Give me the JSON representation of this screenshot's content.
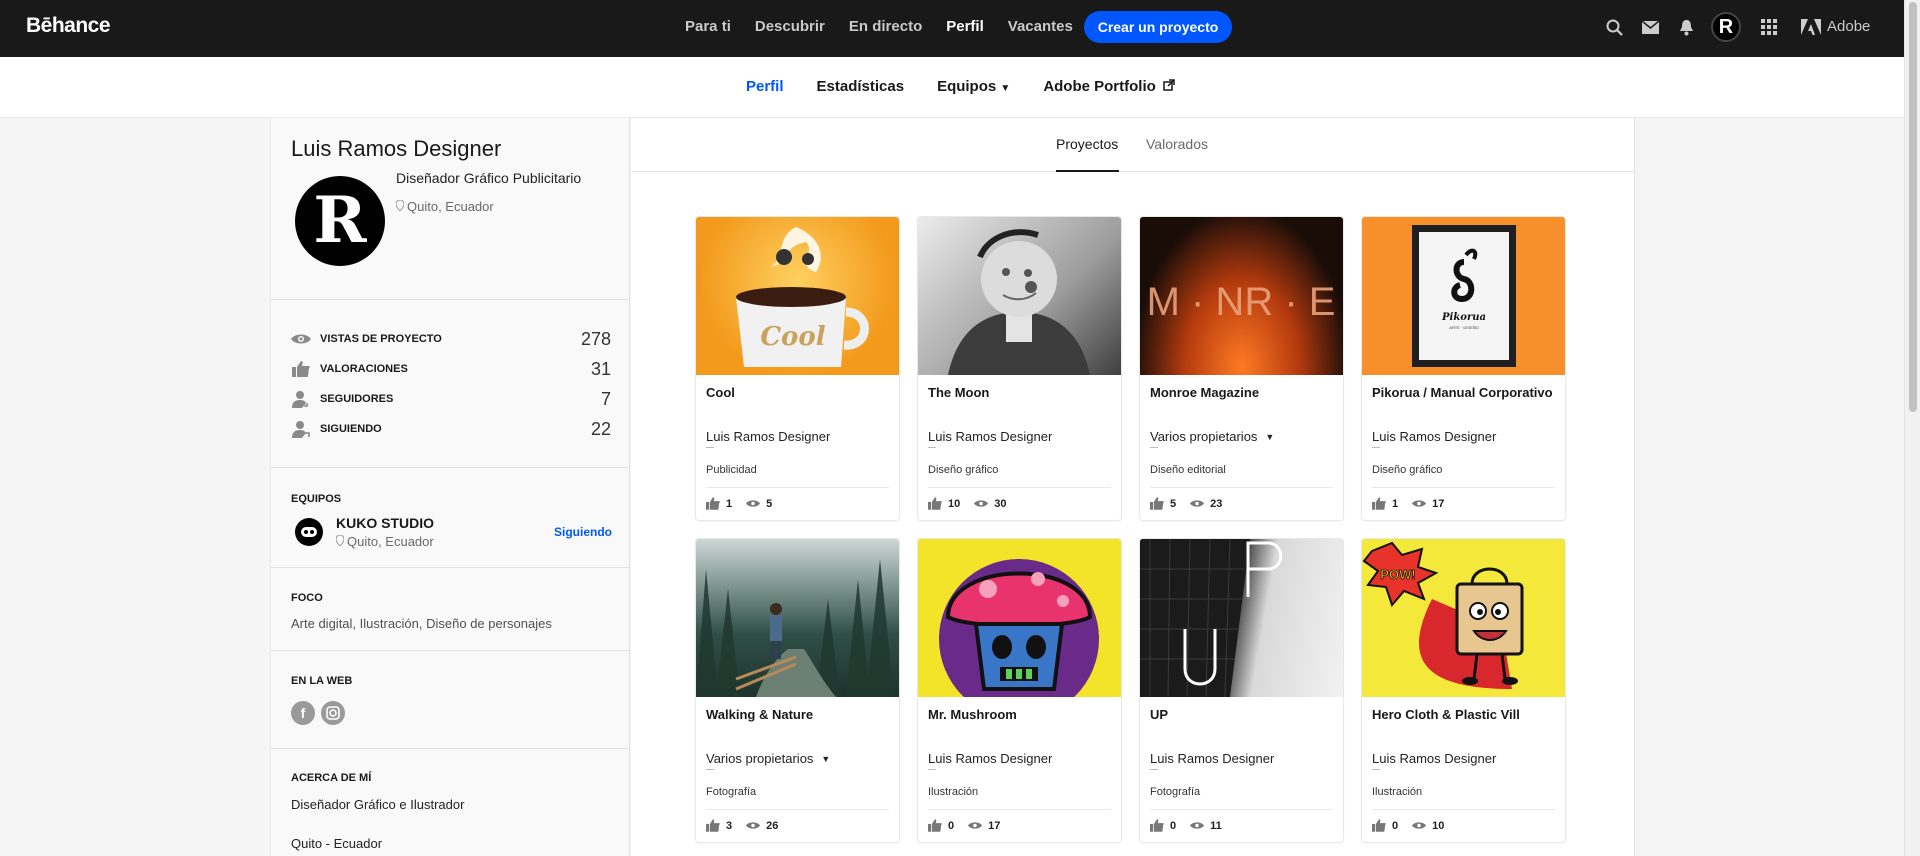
{
  "topnav": {
    "logo": "Bēhance",
    "links": [
      "Para ti",
      "Descubrir",
      "En directo",
      "Perfil",
      "Vacantes"
    ],
    "active_link": "Perfil",
    "create_button": "Crear un proyecto",
    "avatar_letter": "R",
    "adobe_label": "Adobe",
    "icons": [
      "search-icon",
      "mail-icon",
      "bell-icon",
      "apps-grid-icon",
      "adobe-icon"
    ]
  },
  "subnav": {
    "links": [
      "Perfil",
      "Estadísticas",
      "Equipos",
      "Adobe Portfolio"
    ],
    "active": "Perfil"
  },
  "profile": {
    "name": "Luis Ramos Designer",
    "avatar_letter": "R",
    "occupation": "Diseñador Gráfico Publicitario",
    "location": "Quito, Ecuador"
  },
  "stats": [
    {
      "label": "VISTAS DE PROYECTO",
      "value": "278",
      "icon": "eye-icon"
    },
    {
      "label": "VALORACIONES",
      "value": "31",
      "icon": "thumbs-up-icon"
    },
    {
      "label": "SEGUIDORES",
      "value": "7",
      "icon": "followers-icon"
    },
    {
      "label": "SIGUIENDO",
      "value": "22",
      "icon": "following-icon"
    }
  ],
  "teams": {
    "title": "EQUIPOS",
    "name": "KUKO STUDIO",
    "location": "Quito, Ecuador",
    "status": "Siguiendo"
  },
  "focus": {
    "title": "FOCO",
    "text": "Arte digital, Ilustración, Diseño de personajes"
  },
  "web": {
    "title": "EN LA WEB",
    "icons": [
      "facebook-icon",
      "instagram-icon"
    ]
  },
  "about": {
    "title": "ACERCA DE MÍ",
    "line1": "Diseñador Gráfico e Ilustrador",
    "line2": "Quito - Ecuador"
  },
  "tabs": [
    "Proyectos",
    "Valorados"
  ],
  "active_tab": "Proyectos",
  "projects": [
    {
      "title": "Cool",
      "owner": "Luis Ramos Designer",
      "field": "Publicidad",
      "likes": "1",
      "views": "5"
    },
    {
      "title": "The Moon",
      "owner": "Luis Ramos Designer",
      "field": "Diseño gráfico",
      "likes": "10",
      "views": "30"
    },
    {
      "title": "Monroe Magazine",
      "owner": "Varios propietarios",
      "field": "Diseño editorial",
      "likes": "5",
      "views": "23"
    },
    {
      "title": "Pikorua / Manual Corporativo",
      "owner": "Luis Ramos Designer",
      "field": "Diseño gráfico",
      "likes": "1",
      "views": "17"
    },
    {
      "title": "Walking & Nature",
      "owner": "Varios propietarios",
      "field": "Fotografía",
      "likes": "3",
      "views": "26"
    },
    {
      "title": "Mr. Mushroom",
      "owner": "Luis Ramos Designer",
      "field": "Ilustración",
      "likes": "0",
      "views": "17"
    },
    {
      "title": "UP",
      "owner": "Luis Ramos Designer",
      "field": "Fotografía",
      "likes": "0",
      "views": "11"
    },
    {
      "title": "Hero Cloth & Plastic Vill",
      "owner": "Luis Ramos Designer",
      "field": "Ilustración",
      "likes": "0",
      "views": "10"
    }
  ],
  "thumb_text": {
    "cool_mug": "Cool",
    "monroe": "M · NR · E",
    "pikorua": "Pikorua",
    "pikorua_sub": "ARTE · DISEÑO",
    "up": "UP",
    "pow": "POW!"
  },
  "colors": {
    "accent": "#0057ff",
    "topbar": "#191919",
    "cool_bg": "#f4a12a",
    "pikorua_bg": "#f7902a",
    "mushroom_bg": "#f3e42a",
    "hero_bg": "#f4e93a"
  }
}
